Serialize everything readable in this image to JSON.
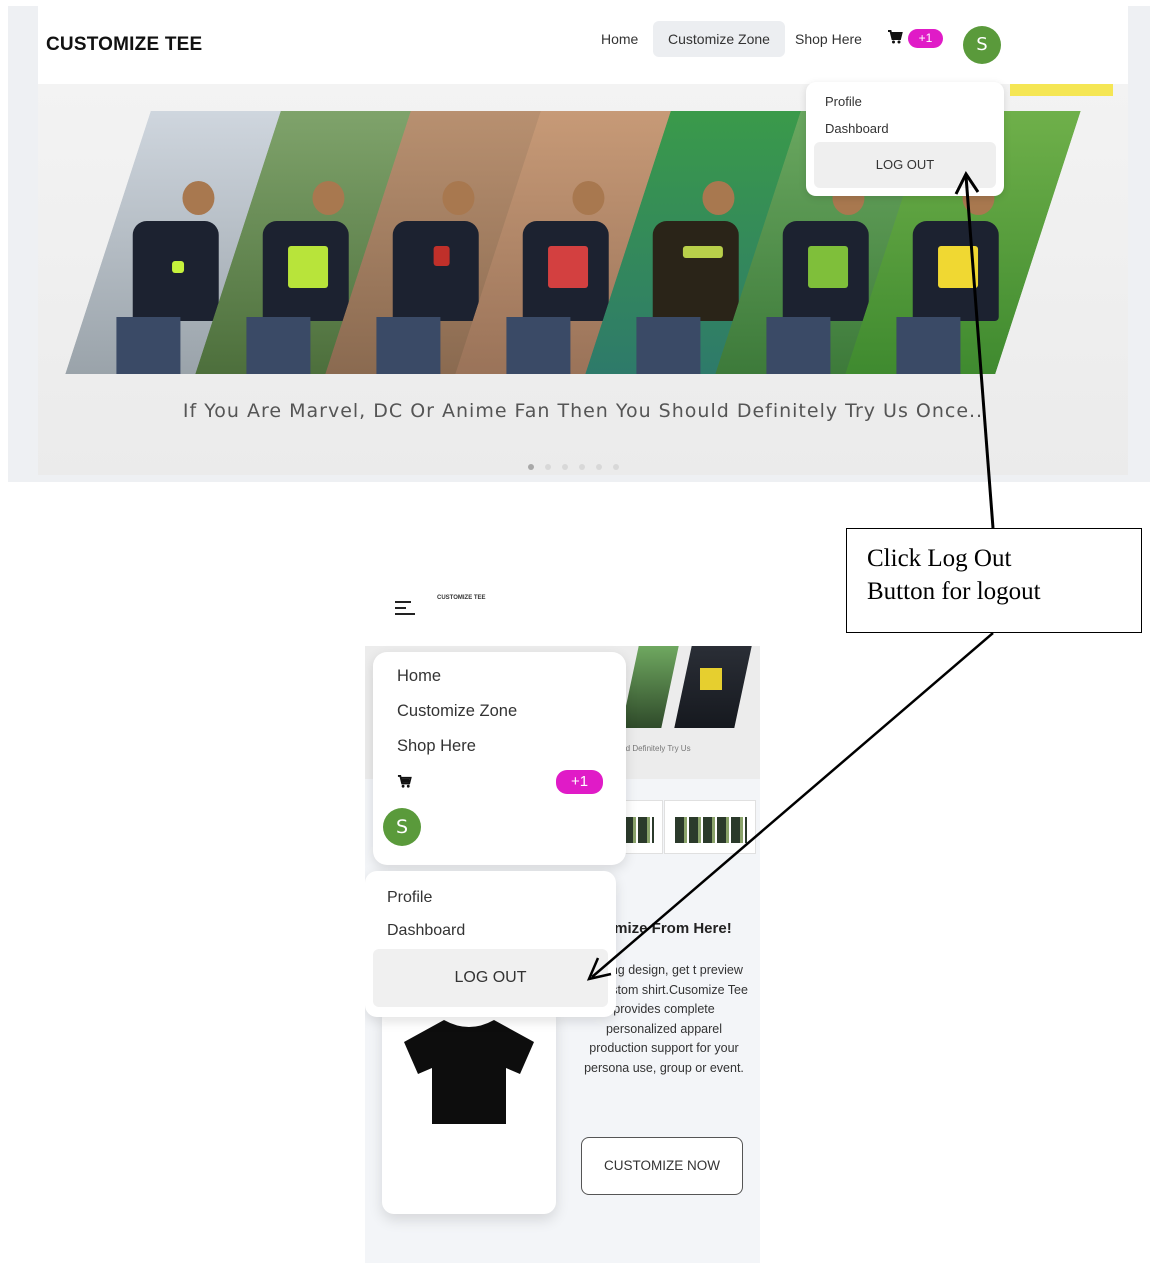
{
  "desktop": {
    "brand": "CUSTOMIZE TEE",
    "nav": {
      "home": "Home",
      "customize_zone": "Customize Zone",
      "shop_here": "Shop Here",
      "cart_icon": "cart-icon",
      "cart_badge": "+1",
      "avatar_initial": "S"
    },
    "dropdown": {
      "profile": "Profile",
      "dashboard": "Dashboard",
      "logout": "LOG OUT"
    },
    "banner": {
      "tagline": "If You Are Marvel, DC Or Anime Fan Then You Should Definitely Try Us Once.."
    }
  },
  "annotation": {
    "callout_line1": "Click Log Out",
    "callout_line2": "Button for logout"
  },
  "mobile": {
    "brand": "CUSTOMIZE TEE",
    "menu": {
      "home": "Home",
      "customize_zone": "Customize Zone",
      "shop_here": "Shop Here",
      "cart_icon": "cart-icon",
      "cart_badge": "+1",
      "avatar_initial": "S"
    },
    "dropdown": {
      "profile": "Profile",
      "dashboard": "Dashboard",
      "logout": "LOG OUT"
    },
    "banner_text": "ould Definitely Try Us",
    "content": {
      "title": "omize From Here!",
      "description": "placing design, get t preview for custom shirt.Cusomize Tee provides complete personalized apparel production support for your persona use, group or event.",
      "button": "CUSTOMIZE NOW"
    }
  },
  "colors": {
    "badge": "#e01bc7",
    "avatar": "#5a9a3b"
  }
}
